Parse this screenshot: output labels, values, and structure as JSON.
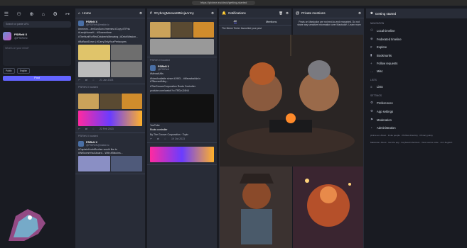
{
  "browser": {
    "url": "https://pixime.eu/deck/getting-started"
  },
  "compose": {
    "search_placeholder": "Search or paste URL",
    "display_name": "PSIReN X",
    "handle": "@PSIReN",
    "textarea_placeholder": "What's on your mind?",
    "visibility": "Public",
    "language": "English",
    "post_label": "Post"
  },
  "home": {
    "title": "Home",
    "posts": [
      {
        "name": "PSIReN X",
        "handle": "@PSIReN@mstdn.ic",
        "text": "#mmmm... #mSunSum #memes #Copy #TFhis #LeetyHomeH... #Sonnentime",
        "extra": "#TheHuntForRedOctoberIsMeowing | #DrichMission...",
        "tags": "#BaBackDown | #CarryOnlyYourPeriscopes",
        "date": "21 Jan 2023"
      },
      {
        "boost": "PSIReN X boosted",
        "name": "PSIReN X",
        "handle": "@PSIReN@mstdn.ic",
        "text": "",
        "date": "22 Feb 2023"
      },
      {
        "boost": "PSIReN X boosted",
        "name": "PSIReN X",
        "handle": "@PSIReN@mstdn.ic",
        "text": "#CaptainHoshtBrother would like to #WelcomeYouAboard... With #Bitcoins...",
        "date": ""
      }
    ]
  },
  "col2": {
    "title": "#CyborgMeowoMNinjaArmy",
    "posts": [
      {
        "boost": "PSIReN X boosted",
        "name": "PSIReN X",
        "handle": "@PSIReN",
        "text": "#MeowlUtils",
        "extra": "#NowAvailable since #1993... #Meowbaidia in #TBurnedAlley...",
        "tags": "#TheGrooveCorporation Roots Controller",
        "link": "youtube.com/watch?v=TRDzJJ4N4",
        "yt": "YouTube",
        "card_title": "Roots controller",
        "card_sub": "By The Groove Corporation · Topic",
        "date": "19 Oct 2023"
      }
    ]
  },
  "notifications": {
    "title": "Notifications",
    "tab_all": "All",
    "tab_mentions": "Mentions",
    "line": "The Meme Terrier favourited your post"
  },
  "private_mentions": {
    "title": "Private mentions",
    "note": "Posts on Mastodon are not end-to-end encrypted. Do not share any sensitive information over Mastodon. Learn more"
  },
  "getting_started": {
    "title": "Getting started",
    "navigation_label": "NAVIGATION",
    "nav_items": [
      "Local timeline",
      "Federated timeline",
      "Explore",
      "Bookmarks",
      "Follow requests",
      "Misc"
    ],
    "lists_label": "LISTS",
    "lists_items": [
      "Lists"
    ],
    "settings_label": "SETTINGS",
    "settings_items": [
      "Preferences",
      "App settings",
      "Moderation",
      "Administration"
    ],
    "footer1": "pixime.eu: About · Invite people · Profiles directory · Privacy policy",
    "footer2": "Mastodon: About · Get the app · Keyboard shortcuts · View source code · v4.1.8+glitch"
  }
}
